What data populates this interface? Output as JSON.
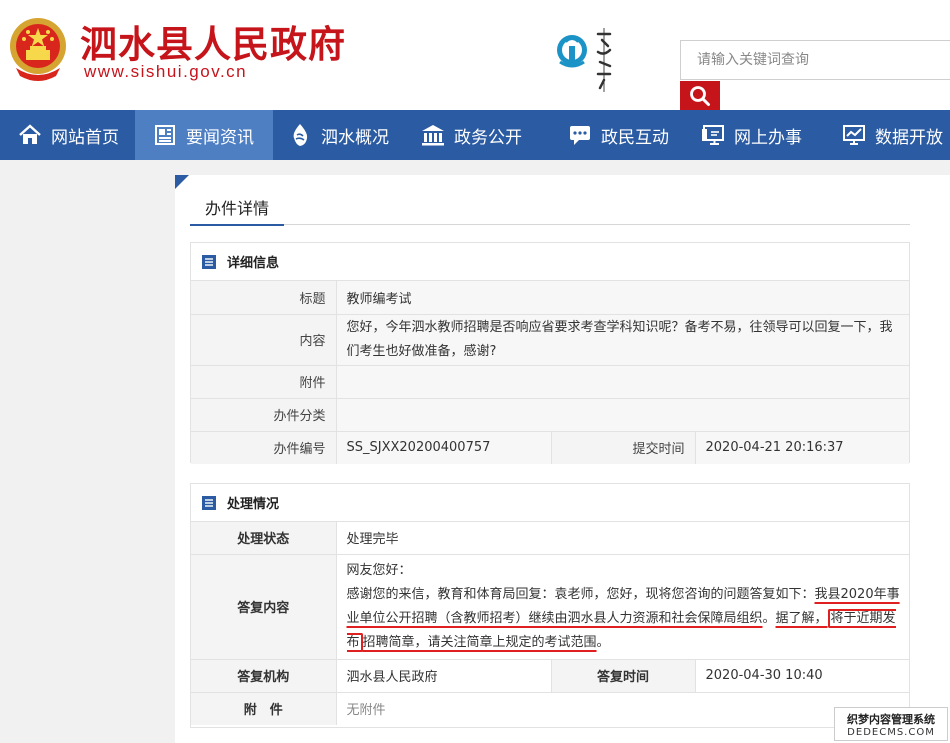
{
  "header": {
    "site_title": "泗水县人民政府",
    "site_url": "www.sishui.gov.cn",
    "search_placeholder": "请输入关键词查询",
    "culture_logo_text": "中国泉乡"
  },
  "nav": {
    "items": [
      {
        "label": "网站首页",
        "icon": "home-icon"
      },
      {
        "label": "要闻资讯",
        "icon": "news-icon",
        "active": true
      },
      {
        "label": "泗水概况",
        "icon": "water-drop-icon"
      },
      {
        "label": "政务公开",
        "icon": "building-icon"
      },
      {
        "label": "政民互动",
        "icon": "chat-icon"
      },
      {
        "label": "网上办事",
        "icon": "monitor-icon"
      },
      {
        "label": "数据开放",
        "icon": "chart-icon"
      }
    ]
  },
  "page": {
    "title": "办件详情"
  },
  "detail": {
    "heading": "详细信息",
    "title_label": "标题",
    "title_value": "教师编考试",
    "content_label": "内容",
    "content_value": "您好，今年泗水教师招聘是否响应省要求考查学科知识呢？备考不易，往领导可以回复一下，我们考生也好做准备，感谢?",
    "attachment_label": "附件",
    "attachment_value": "",
    "category_label": "办件分类",
    "category_value": "",
    "number_label": "办件编号",
    "number_value": "SS_SJXX20200400757",
    "submit_time_label": "提交时间",
    "submit_time_value": "2020-04-21 20:16:37"
  },
  "processing": {
    "heading": "处理情况",
    "status_label": "处理状态",
    "status_value": "处理完毕",
    "reply_label": "答复内容",
    "reply_greeting": "网友您好：",
    "reply_part1": "感谢您的来信，教育和体育局回复：袁老师，您好，现将您咨询的问题答复如下：",
    "reply_part2": "我县2020年事业单位公开招聘（含教师招考）继续由泗水县人力资源和社会保障局组织",
    "reply_part3": "。",
    "reply_part4": "据了解，",
    "reply_part5": "将于近期发布",
    "reply_part6": "招聘简章，请关注简章上规定的考试范围",
    "reply_part7": "。",
    "org_label": "答复机构",
    "org_value": "泗水县人民政府",
    "reply_time_label": "答复时间",
    "reply_time_value": "2020-04-30 10:40",
    "attachment_label": "附　件",
    "attachment_value": "无附件"
  },
  "watermark": {
    "line1": "织梦内容管理系统",
    "line2": "DEDECMS.COM"
  }
}
